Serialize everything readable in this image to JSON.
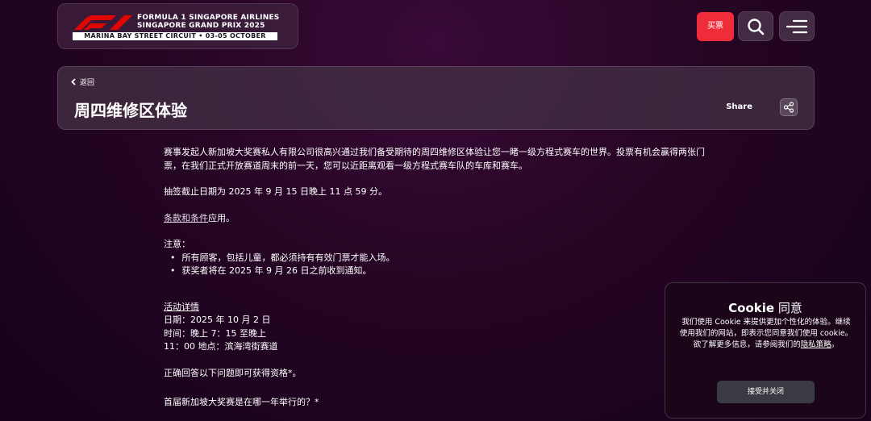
{
  "header": {
    "logo_line1": "FORMULA 1 SINGAPORE AIRLINES",
    "logo_line2": "SINGAPORE GRAND PRIX 2025",
    "logo_strip": "MARINA BAY STREET CIRCUIT • 03-05 OCTOBER",
    "ticket_label": "买票"
  },
  "title_card": {
    "back_label": "返回",
    "title": "周四维修区体验",
    "share_label": "Share"
  },
  "content": {
    "intro": "赛事发起人新加坡大奖赛私人有限公司很高兴通过我们备受期待的周四维修区体验让您一睹一级方程式赛车的世界。投票有机会赢得两张门票，在我们正式开放赛道周末的前一天，您可以近距离观看一级方程式赛车队的车库和赛车。",
    "deadline": "抽签截止日期为 2025 年 9 月 15 日晚上 11 点 59 分。",
    "terms_link": "条款和条件",
    "terms_suffix": "应用。",
    "note_title": "注意：",
    "notes": [
      "所有顾客，包括儿童，都必须持有有效门票才能入场。",
      "获奖者将在 2025 年 9 月 26 日之前收到通知。"
    ],
    "activity_title": "活动详情",
    "activity_date": "日期：2025 年 10 月 2 日",
    "activity_time": "时间：晚上 7：15 至晚上",
    "activity_place": "11：00 地点：滨海湾街赛道",
    "qualify": "正确回答以下问题即可获得资格*。",
    "question": "首届新加坡大奖赛是在哪一年举行的？*"
  },
  "cookie": {
    "title_bold": "Cookie",
    "title_rest": " 同意",
    "text": "我们使用 Cookie 来提供更加个性化的体验。继续使用我们的网站，即表示您同意我们使用 cookie。欲了解更多信息，请参阅我们的",
    "link": "隐私策略",
    "text_end": "。",
    "button": "接受并关闭"
  },
  "colors": {
    "accent_red": "#ef2c3a",
    "background": "#250524"
  }
}
